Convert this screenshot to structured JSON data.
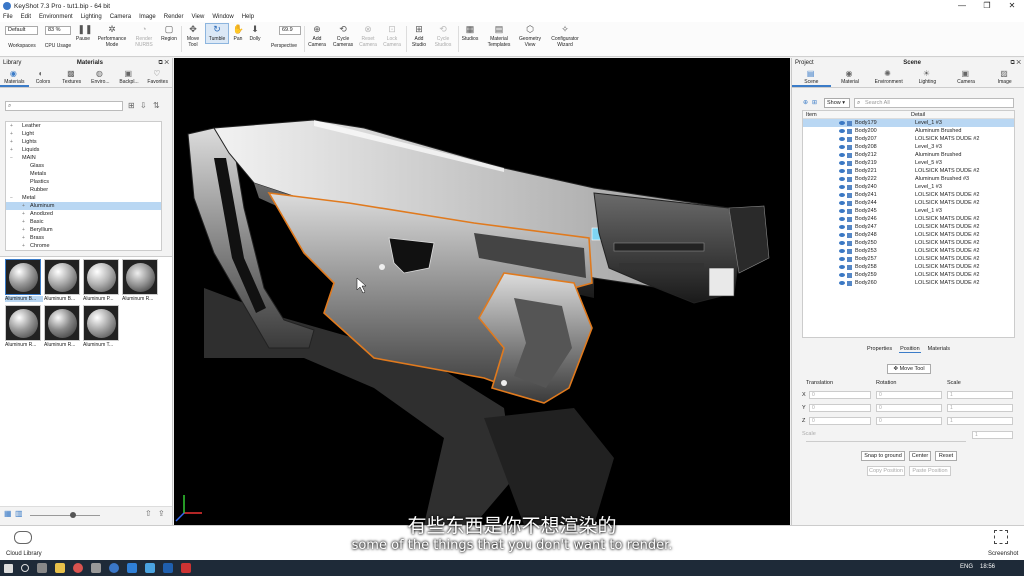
{
  "window": {
    "title": "KeyShot 7.3 Pro  -  tut1.bip  -  64 bit",
    "controls": [
      "—",
      "❐",
      "✕"
    ]
  },
  "menu": [
    "File",
    "Edit",
    "Environment",
    "Lighting",
    "Camera",
    "Image",
    "Render",
    "View",
    "Window",
    "Help"
  ],
  "ribbon": {
    "workspace_value": "Default",
    "cpu_value": "83 %",
    "fov_value": "69.9",
    "workspaces": "Workspaces",
    "cpu": "CPU Usage",
    "pause": "Pause",
    "performance": "Performance Mode",
    "render_nurbs": "Render NURBS",
    "region": "Region",
    "move_tool": "Move Tool",
    "tumble": "Tumble",
    "pan": "Pan",
    "dolly": "Dolly",
    "perspective": "Perspective",
    "add_camera": "Add Camera",
    "cycle_cameras": "Cycle Cameras",
    "reset_camera": "Reset Camera",
    "lock_camera": "Lock Camera",
    "add_studio": "Add Studio",
    "cycle_studios": "Cycle Studios",
    "studios": "Studios",
    "material_templates": "Material Templates",
    "geometry_view": "Geometry View",
    "configurator_wizard": "Configurator Wizard"
  },
  "library": {
    "header_left": "Library",
    "header_center": "Materials",
    "tabs": [
      "Materials",
      "Colors",
      "Textures",
      "Enviro...",
      "Backpl...",
      "Favorites"
    ],
    "tree": [
      "Leather",
      "Light",
      "Lights",
      "Liquids",
      "MAIN",
      "Glass",
      "Metals",
      "Plastics",
      "Rubber",
      "Metal",
      "Aluminum",
      "Anodized",
      "Basic",
      "Beryllium",
      "Brass",
      "Chrome"
    ],
    "thumbs": [
      "Aluminum B...",
      "Aluminum B...",
      "Aluminum P...",
      "Aluminum R...",
      "Aluminum R...",
      "Aluminum R...",
      "Aluminum T..."
    ],
    "footer": "Cloud Library"
  },
  "project": {
    "header_left": "Project",
    "header_center": "Scene",
    "tabs": [
      "Scene",
      "Material",
      "Environment",
      "Lighting",
      "Camera",
      "Image"
    ],
    "show": "Show",
    "search_placeholder": "Search All",
    "col_item": "Item",
    "col_detail": "Detail",
    "rows": [
      [
        "Body179",
        "Level_1 #3"
      ],
      [
        "Body200",
        "Aluminum Brushed"
      ],
      [
        "Body207",
        "LOLSICK MATS DUDE #2"
      ],
      [
        "Body208",
        "Level_3 #3"
      ],
      [
        "Body212",
        "Aluminum Brushed"
      ],
      [
        "Body219",
        "Level_5 #3"
      ],
      [
        "Body221",
        "LOLSICK MATS DUDE #2"
      ],
      [
        "Body222",
        "Aluminum Brushed #3"
      ],
      [
        "Body240",
        "Level_1 #3"
      ],
      [
        "Body241",
        "LOLSICK MATS DUDE #2"
      ],
      [
        "Body244",
        "LOLSICK MATS DUDE #2"
      ],
      [
        "Body245",
        "Level_1 #3"
      ],
      [
        "Body246",
        "LOLSICK MATS DUDE #2"
      ],
      [
        "Body247",
        "LOLSICK MATS DUDE #2"
      ],
      [
        "Body248",
        "LOLSICK MATS DUDE #2"
      ],
      [
        "Body250",
        "LOLSICK MATS DUDE #2"
      ],
      [
        "Body253",
        "LOLSICK MATS DUDE #2"
      ],
      [
        "Body257",
        "LOLSICK MATS DUDE #2"
      ],
      [
        "Body258",
        "LOLSICK MATS DUDE #2"
      ],
      [
        "Body259",
        "LOLSICK MATS DUDE #2"
      ],
      [
        "Body260",
        "LOLSICK MATS DUDE #2"
      ]
    ],
    "subtabs": [
      "Properties",
      "Position",
      "Materials"
    ],
    "move_tool": "Move Tool",
    "translation": "Translation",
    "rotation": "Rotation",
    "scale": "Scale",
    "axes": [
      "X",
      "Y",
      "Z"
    ],
    "scale_label": "Scale",
    "field_zero": "0",
    "field_one": "1",
    "snap": "Snap to ground",
    "center": "Center",
    "reset": "Reset",
    "copy": "Copy Position",
    "paste": "Paste Position"
  },
  "bottom": {
    "screenshot": "Screenshot"
  },
  "subtitles": {
    "cn": "有些东西是你不想渲染的",
    "en": "some of the things that you don't want to render."
  },
  "taskbar": {
    "lang": "ENG",
    "time": "18:56"
  },
  "colors": {
    "accent": "#3b7cc8",
    "selection": "#b9d7f3",
    "outline": "#e07a1e",
    "cyan": "#7fd4f2"
  }
}
